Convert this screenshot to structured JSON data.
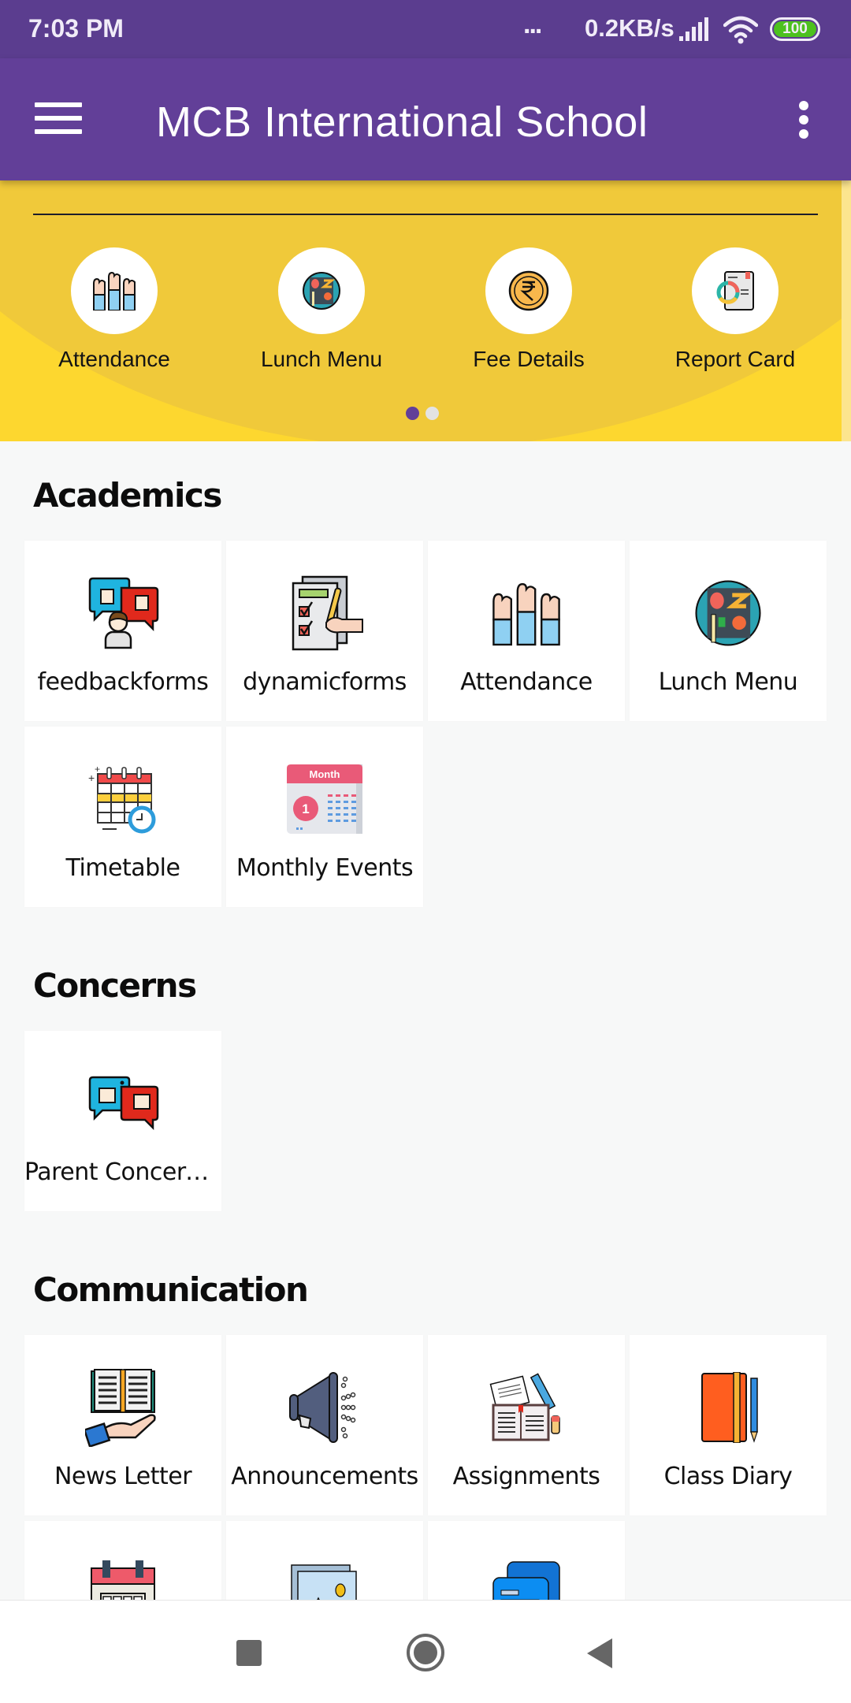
{
  "status_bar": {
    "time": "7:03 PM",
    "overflow_dots": "...",
    "network_speed": "0.2KB/s",
    "battery_level": "100",
    "battery_color": "#4DC11E"
  },
  "toolbar": {
    "title": "MCB International School",
    "menu_icon": "hamburger-menu-icon",
    "overflow_icon": "more-vert-icon",
    "color": "#623F98"
  },
  "banner": {
    "color": "#FDD72F",
    "items": [
      {
        "label": "Attendance",
        "icon": "raised-hands-icon"
      },
      {
        "label": "Lunch Menu",
        "icon": "lunch-plate-icon"
      },
      {
        "label": "Fee Details",
        "icon": "rupee-coin-icon"
      },
      {
        "label": "Report Card",
        "icon": "report-card-icon"
      }
    ],
    "pager": {
      "pages": 2,
      "current": 1
    }
  },
  "sections": [
    {
      "title": "Academics",
      "items": [
        {
          "label": "feedbackforms",
          "icon": "feedback-bubbles-icon"
        },
        {
          "label": "dynamicforms",
          "icon": "checklist-form-icon"
        },
        {
          "label": "Attendance",
          "icon": "raised-hands-icon"
        },
        {
          "label": "Lunch Menu",
          "icon": "lunch-plate-icon"
        },
        {
          "label": "Timetable",
          "icon": "timetable-calendar-icon"
        },
        {
          "label": "Monthly Events",
          "icon": "month-calendar-icon"
        }
      ]
    },
    {
      "title": "Concerns",
      "items": [
        {
          "label": "Parent Concern…",
          "icon": "thumbs-bubbles-icon"
        }
      ]
    },
    {
      "title": "Communication",
      "items": [
        {
          "label": "News Letter",
          "icon": "newsletter-book-icon"
        },
        {
          "label": "Announcements",
          "icon": "megaphone-icon"
        },
        {
          "label": "Assignments",
          "icon": "assignment-book-icon"
        },
        {
          "label": "Class Diary",
          "icon": "diary-icon"
        },
        {
          "label": "",
          "icon": "calendar-grid-icon"
        },
        {
          "label": "",
          "icon": "gallery-icon"
        },
        {
          "label": "",
          "icon": "chat-messages-icon"
        }
      ]
    }
  ],
  "nav_bar": {
    "recents": "recents-square-icon",
    "home": "home-circle-icon",
    "back": "back-triangle-icon"
  }
}
